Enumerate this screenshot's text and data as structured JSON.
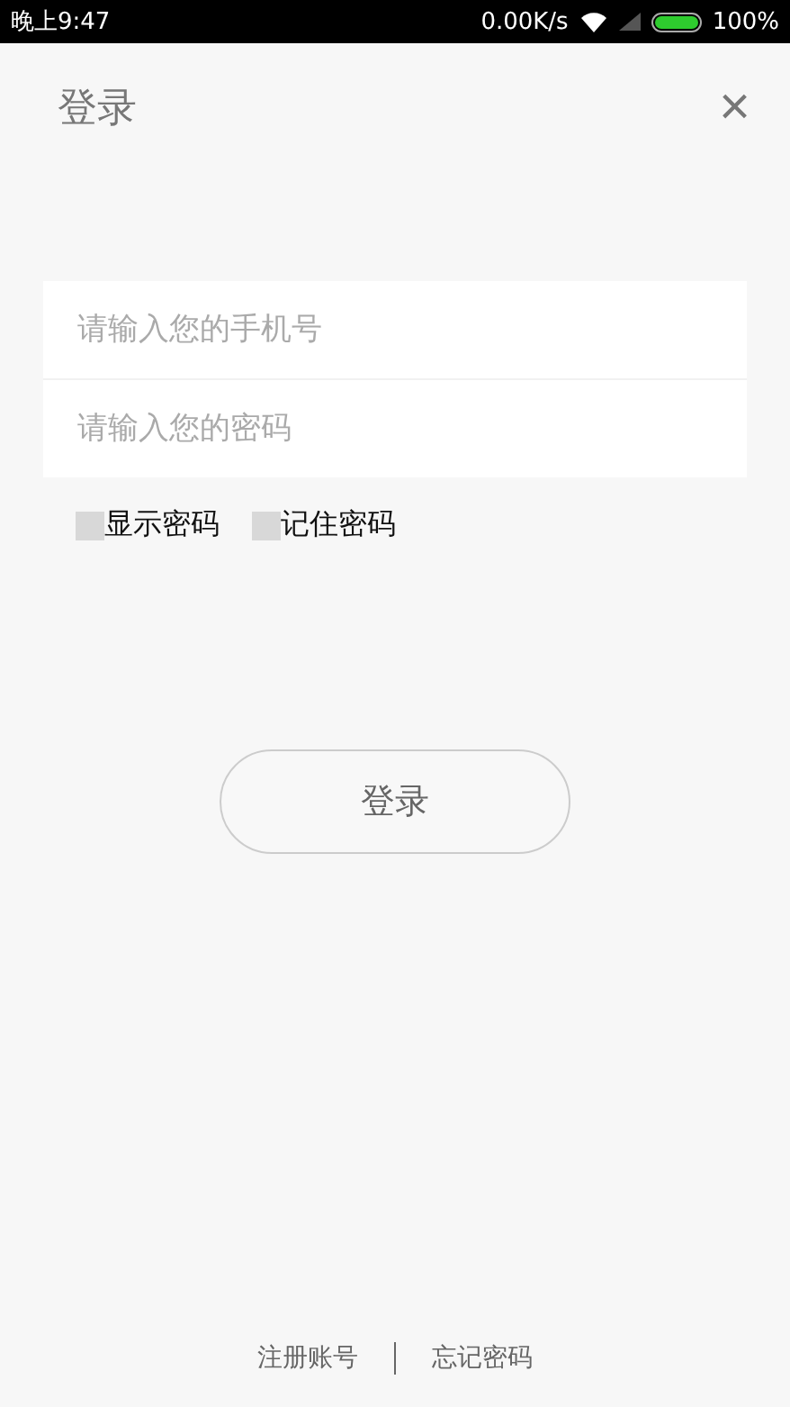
{
  "status_bar": {
    "time": "晚上9:47",
    "speed": "0.00K/s",
    "battery": "100%"
  },
  "header": {
    "title": "登录",
    "close": "×"
  },
  "fields": [
    {
      "placeholder": "请输入您的手机号"
    },
    {
      "placeholder": "请输入您的密码"
    }
  ],
  "options": [
    {
      "label": "显示密码",
      "checked": false
    },
    {
      "label": "记住密码",
      "checked": false
    }
  ],
  "login_button": "登录",
  "footer_links": [
    "注册账号",
    "忘记密码"
  ]
}
